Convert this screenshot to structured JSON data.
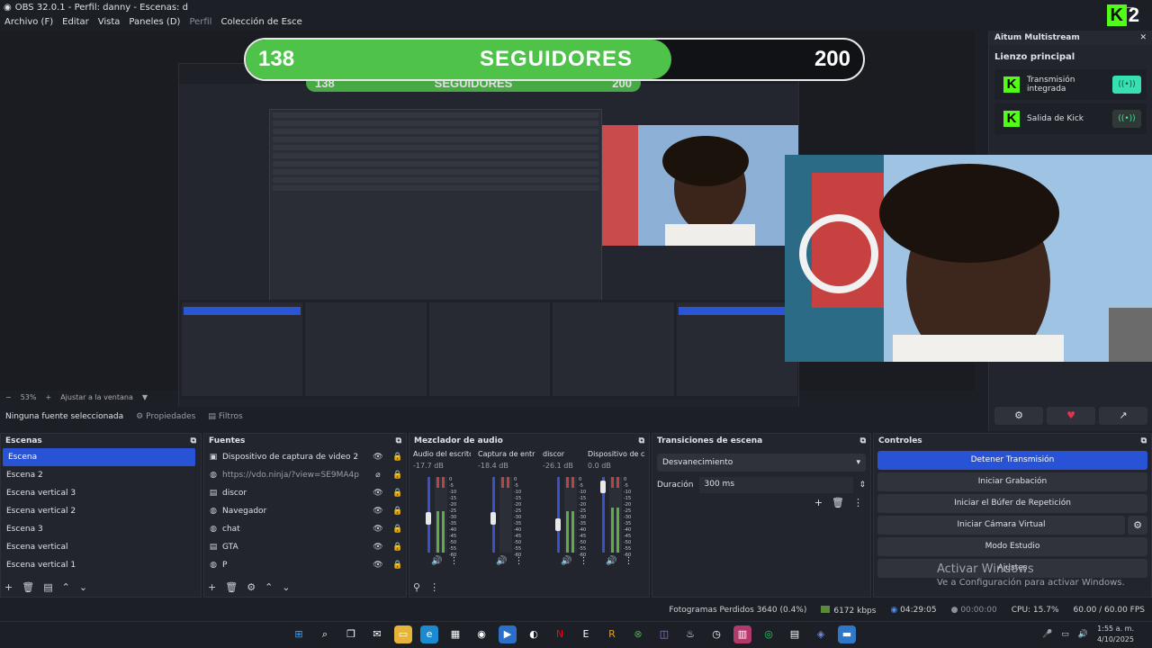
{
  "window": {
    "title": "OBS 32.0.1 - Perfil: danny - Escenas: d"
  },
  "menu": [
    "Archivo (F)",
    "Editar",
    "Vista",
    "Paneles (D)",
    "Perfil",
    "Colección de Esce"
  ],
  "overlay": {
    "current": "138",
    "label": "SEGUIDORES",
    "goal": "200",
    "progress": 0.69,
    "brand_number": "2",
    "colors": {
      "fill": "#4fc24a",
      "kick": "#53fc18"
    }
  },
  "preview_footer": {
    "zoom": "53%",
    "fit": "Ajustar a la ventana"
  },
  "multistream": {
    "title": "Aitum Multistream",
    "section": "Lienzo principal",
    "outputs": [
      {
        "label": "Transmisión integrada",
        "state": "on"
      },
      {
        "label": "Salida de Kick",
        "state": "off"
      }
    ]
  },
  "source_bar": {
    "selected": "Ninguna fuente seleccionada",
    "properties": "Propiedades",
    "filters": "Filtros"
  },
  "scenes": {
    "title": "Escenas",
    "items": [
      "Escena",
      "Escena 2",
      "Escena vertical 3",
      "Escena vertical 2",
      "Escena 3",
      "Escena vertical",
      "Escena vertical 1"
    ]
  },
  "sources": {
    "title": "Fuentes",
    "items": [
      {
        "name": "Dispositivo de captura de video 2",
        "icon": "camera-icon"
      },
      {
        "name": "https://vdo.ninja/?view=SE9MA4p",
        "icon": "globe-icon"
      },
      {
        "name": "discor",
        "icon": "window-icon"
      },
      {
        "name": "Navegador",
        "icon": "globe-icon"
      },
      {
        "name": "chat",
        "icon": "globe-icon"
      },
      {
        "name": "GTA",
        "icon": "window-icon"
      },
      {
        "name": "P",
        "icon": "globe-icon"
      }
    ]
  },
  "mixer": {
    "title": "Mezclador de audio",
    "channels": [
      {
        "name": "Audio del escritorio",
        "db": "-17.7 dB",
        "level": 0.55,
        "fader": 0.45
      },
      {
        "name": "Captura de entrada",
        "db": "-18.4 dB",
        "level": 0.0,
        "fader": 0.45
      },
      {
        "name": "discor",
        "db": "-26.1 dB",
        "level": 0.55,
        "fader": 0.35
      },
      {
        "name": "Dispositivo de capt",
        "db": "0.0 dB",
        "level": 0.6,
        "fader": 0.95
      }
    ],
    "scale": [
      "0",
      "-5",
      "-10",
      "-15",
      "-20",
      "-25",
      "-30",
      "-35",
      "-40",
      "-45",
      "-50",
      "-55",
      "-60"
    ]
  },
  "transitions": {
    "title": "Transiciones de escena",
    "selected": "Desvanecimiento",
    "duration_label": "Duración",
    "duration": "300 ms"
  },
  "controls": {
    "title": "Controles",
    "buttons": [
      "Detener Transmisión",
      "Iniciar Grabación",
      "Iniciar el Búfer de Repetición",
      "Iniciar Cámara Virtual",
      "Modo Estudio",
      "Ajustes"
    ]
  },
  "watermark": {
    "line1": "Activar Windows",
    "line2": "Ve a Configuración para activar Windows."
  },
  "status": {
    "dropped": "Fotogramas Perdidos 3640 (0.4%)",
    "bitrate": "6172 kbps",
    "stream_time": "04:29:05",
    "rec_time": "00:00:00",
    "cpu": "CPU: 15.7%",
    "fps": "60.00 / 60.00 FPS"
  },
  "taskbar": {
    "time": "1:55 a. m.",
    "date": "4/10/2025"
  }
}
